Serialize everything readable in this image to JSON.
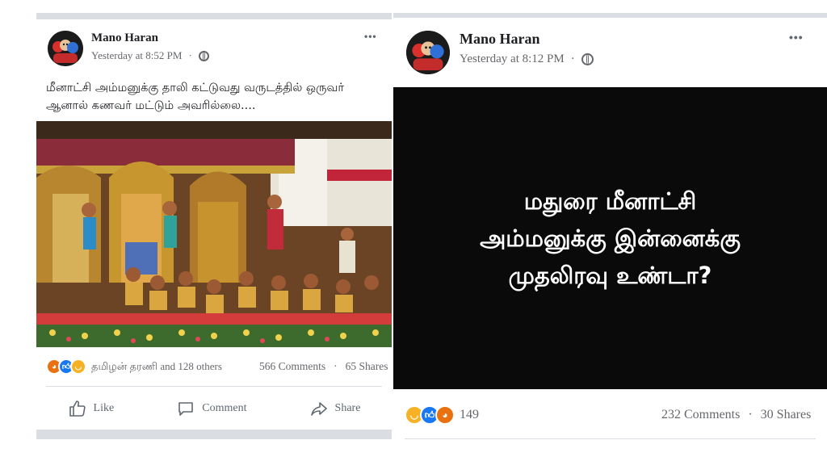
{
  "left_post": {
    "author": "Mano Haran",
    "timestamp": "Yesterday at 8:52 PM",
    "privacy_icon": "globe-icon",
    "more_label": "•••",
    "caption_line1": "மீனாட்சி அம்மனுக்கு தாலி கட்டுவது வருடத்தில் ஒருவர்",
    "caption_line2": "ஆனால் கணவர் மட்டும் அவரில்லை....",
    "reactions": [
      "angry",
      "like",
      "haha"
    ],
    "reactions_text": "தமிழன் தரணி and 128 others",
    "comments": "566 Comments",
    "shares": "65 Shares",
    "stats_sep": "·",
    "actions": {
      "like": "Like",
      "comment": "Comment",
      "share": "Share"
    }
  },
  "right_post": {
    "author": "Mano Haran",
    "timestamp": "Yesterday at 8:12 PM",
    "privacy_icon": "globe-icon",
    "more_label": "•••",
    "image_text": "மதுரை மீனாட்சி\nஅம்மனுக்கு இன்னைக்கு\nமுதலிரவு உண்டா?",
    "reactions": [
      "haha",
      "like",
      "angry"
    ],
    "reactions_count": "149",
    "comments": "232 Comments",
    "shares": "30 Shares",
    "stats_sep": "·"
  },
  "colors": {
    "card_bg": "#ffffff",
    "separator": "#dadde1",
    "meta_text": "#65676b",
    "like_blue": "#1877f2",
    "angry_orange": "#e9710f",
    "haha_yellow": "#f7b125",
    "image_card_bg": "#0a0a0a"
  }
}
